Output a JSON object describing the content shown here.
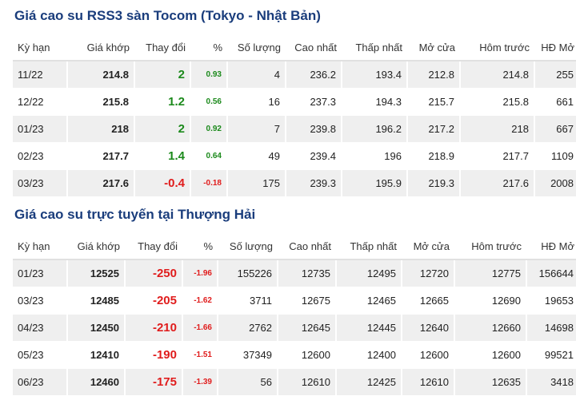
{
  "colors": {
    "title": "#1a3d7c",
    "up": "#1c8a1c",
    "down": "#e01c1c",
    "row_stripe": "#efefef"
  },
  "tocom": {
    "title": "Giá cao su RSS3 sàn Tocom (Tokyo - Nhật Bản)",
    "headers": [
      "Kỳ hạn",
      "Giá khớp",
      "Thay đổi",
      "%",
      "Số lượng",
      "Cao nhất",
      "Thấp nhất",
      "Mở cửa",
      "Hôm trước",
      "HĐ Mở"
    ],
    "rows": [
      {
        "term": "11/22",
        "price": "214.8",
        "change": "2",
        "pct": "0.93",
        "volume": "4",
        "high": "236.2",
        "low": "193.4",
        "open": "212.8",
        "prev": "214.8",
        "oi": "255",
        "dir": "up"
      },
      {
        "term": "12/22",
        "price": "215.8",
        "change": "1.2",
        "pct": "0.56",
        "volume": "16",
        "high": "237.3",
        "low": "194.3",
        "open": "215.7",
        "prev": "215.8",
        "oi": "661",
        "dir": "up"
      },
      {
        "term": "01/23",
        "price": "218",
        "change": "2",
        "pct": "0.92",
        "volume": "7",
        "high": "239.8",
        "low": "196.2",
        "open": "217.2",
        "prev": "218",
        "oi": "667",
        "dir": "up"
      },
      {
        "term": "02/23",
        "price": "217.7",
        "change": "1.4",
        "pct": "0.64",
        "volume": "49",
        "high": "239.4",
        "low": "196",
        "open": "218.9",
        "prev": "217.7",
        "oi": "1109",
        "dir": "up"
      },
      {
        "term": "03/23",
        "price": "217.6",
        "change": "-0.4",
        "pct": "-0.18",
        "volume": "175",
        "high": "239.3",
        "low": "195.9",
        "open": "219.3",
        "prev": "217.6",
        "oi": "2008",
        "dir": "down"
      }
    ]
  },
  "shanghai": {
    "title": "Giá cao su trực tuyến tại Thượng Hải",
    "headers": [
      "Kỳ hạn",
      "Giá khớp",
      "Thay đổi",
      "%",
      "Số lượng",
      "Cao nhất",
      "Thấp nhất",
      "Mở cửa",
      "Hôm trước",
      "HĐ Mở"
    ],
    "rows": [
      {
        "term": "01/23",
        "price": "12525",
        "change": "-250",
        "pct": "-1.96",
        "volume": "155226",
        "high": "12735",
        "low": "12495",
        "open": "12720",
        "prev": "12775",
        "oi": "156644",
        "dir": "down"
      },
      {
        "term": "03/23",
        "price": "12485",
        "change": "-205",
        "pct": "-1.62",
        "volume": "3711",
        "high": "12675",
        "low": "12465",
        "open": "12665",
        "prev": "12690",
        "oi": "19653",
        "dir": "down"
      },
      {
        "term": "04/23",
        "price": "12450",
        "change": "-210",
        "pct": "-1.66",
        "volume": "2762",
        "high": "12645",
        "low": "12445",
        "open": "12640",
        "prev": "12660",
        "oi": "14698",
        "dir": "down"
      },
      {
        "term": "05/23",
        "price": "12410",
        "change": "-190",
        "pct": "-1.51",
        "volume": "37349",
        "high": "12600",
        "low": "12400",
        "open": "12600",
        "prev": "12600",
        "oi": "99521",
        "dir": "down"
      },
      {
        "term": "06/23",
        "price": "12460",
        "change": "-175",
        "pct": "-1.39",
        "volume": "56",
        "high": "12610",
        "low": "12425",
        "open": "12610",
        "prev": "12635",
        "oi": "3418",
        "dir": "down"
      }
    ]
  }
}
